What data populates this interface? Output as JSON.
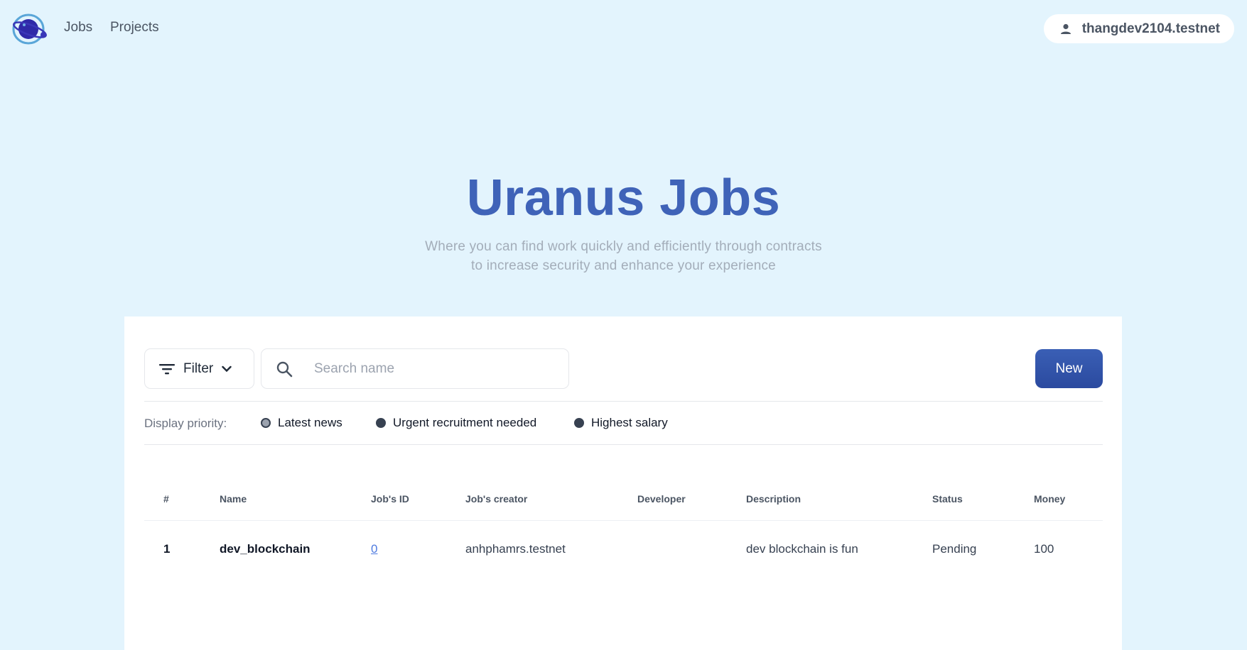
{
  "nav": {
    "logo": "planet-logo",
    "links": [
      "Jobs",
      "Projects"
    ],
    "account": "thangdev2104.testnet"
  },
  "hero": {
    "title": "Uranus Jobs",
    "subtitle_line1": "Where you can find work quickly and efficiently through contracts",
    "subtitle_line2": "to increase security and enhance your experience"
  },
  "toolbar": {
    "filter_label": "Filter",
    "search_placeholder": "Search name",
    "new_label": "New"
  },
  "priority": {
    "label": "Display priority:",
    "options": [
      "Latest news",
      "Urgent recruitment needed",
      "Highest salary"
    ],
    "selected": "Latest news"
  },
  "table": {
    "headers": [
      "#",
      "Name",
      "Job's ID",
      "Job's creator",
      "Developer",
      "Description",
      "Status",
      "Money"
    ],
    "rows": [
      {
        "num": "1",
        "name": "dev_blockchain",
        "id": "0",
        "creator": "anhphamrs.testnet",
        "developer": "",
        "description": "dev blockchain is fun",
        "status": "Pending",
        "money": "100"
      }
    ]
  },
  "colors": {
    "background": "#e3f4fd",
    "accent": "#3f63b8",
    "button": "#2f4fa6"
  }
}
